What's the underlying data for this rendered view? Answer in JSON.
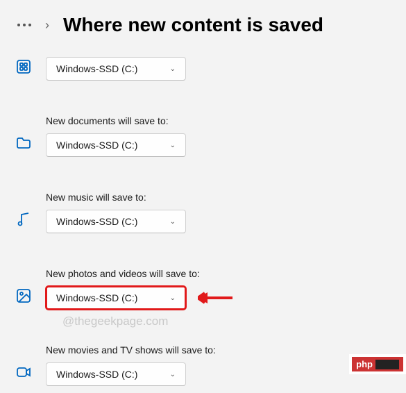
{
  "header": {
    "title": "Where new content is saved"
  },
  "settings": {
    "apps": {
      "value": "Windows-SSD (C:)"
    },
    "documents": {
      "label": "New documents will save to:",
      "value": "Windows-SSD (C:)"
    },
    "music": {
      "label": "New music will save to:",
      "value": "Windows-SSD (C:)"
    },
    "photos": {
      "label": "New photos and videos will save to:",
      "value": "Windows-SSD (C:)"
    },
    "movies": {
      "label": "New movies and TV shows will save to:",
      "value": "Windows-SSD (C:)"
    }
  },
  "watermark": "@thegeekpage.com",
  "badge": "php"
}
